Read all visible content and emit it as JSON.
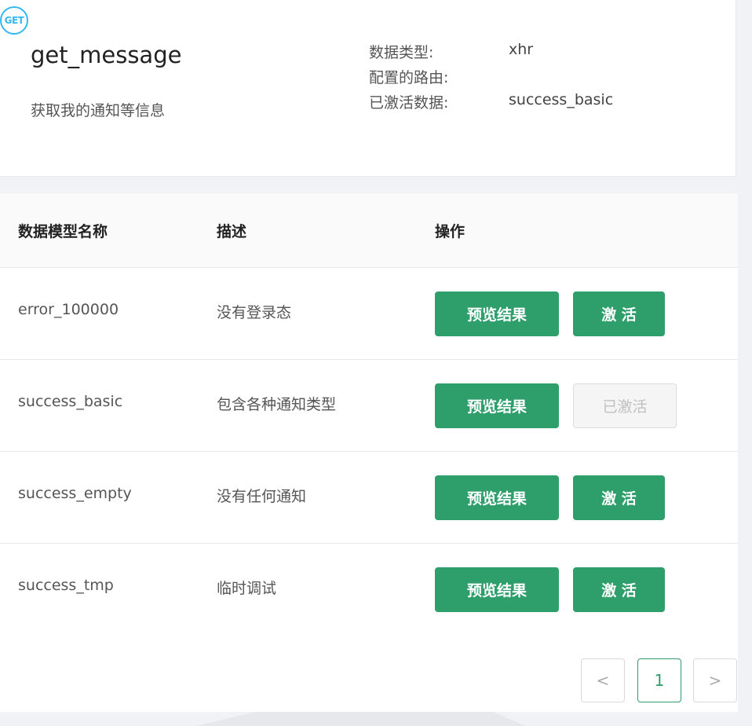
{
  "api": {
    "method": "GET",
    "name": "get_message",
    "description": "获取我的通知等信息"
  },
  "meta": [
    {
      "label": "数据类型:",
      "value": "xhr"
    },
    {
      "label": "配置的路由:",
      "value": ""
    },
    {
      "label": "已激活数据:",
      "value": "success_basic"
    }
  ],
  "table": {
    "headers": {
      "name": "数据模型名称",
      "desc": "描述",
      "ops": "操作"
    },
    "rows": [
      {
        "name": "error_100000",
        "desc": "没有登录态",
        "preview": "预览结果",
        "activate": "激 活",
        "active": false
      },
      {
        "name": "success_basic",
        "desc": "包含各种通知类型",
        "preview": "预览结果",
        "activate": "已激活",
        "active": true
      },
      {
        "name": "success_empty",
        "desc": "没有任何通知",
        "preview": "预览结果",
        "activate": "激 活",
        "active": false
      },
      {
        "name": "success_tmp",
        "desc": "临时调试",
        "preview": "预览结果",
        "activate": "激 活",
        "active": false
      }
    ]
  },
  "pagination": {
    "prev": "<",
    "current": "1",
    "next": ">"
  },
  "colors": {
    "primary": "#2e9e6b",
    "badge": "#33b8f0"
  }
}
